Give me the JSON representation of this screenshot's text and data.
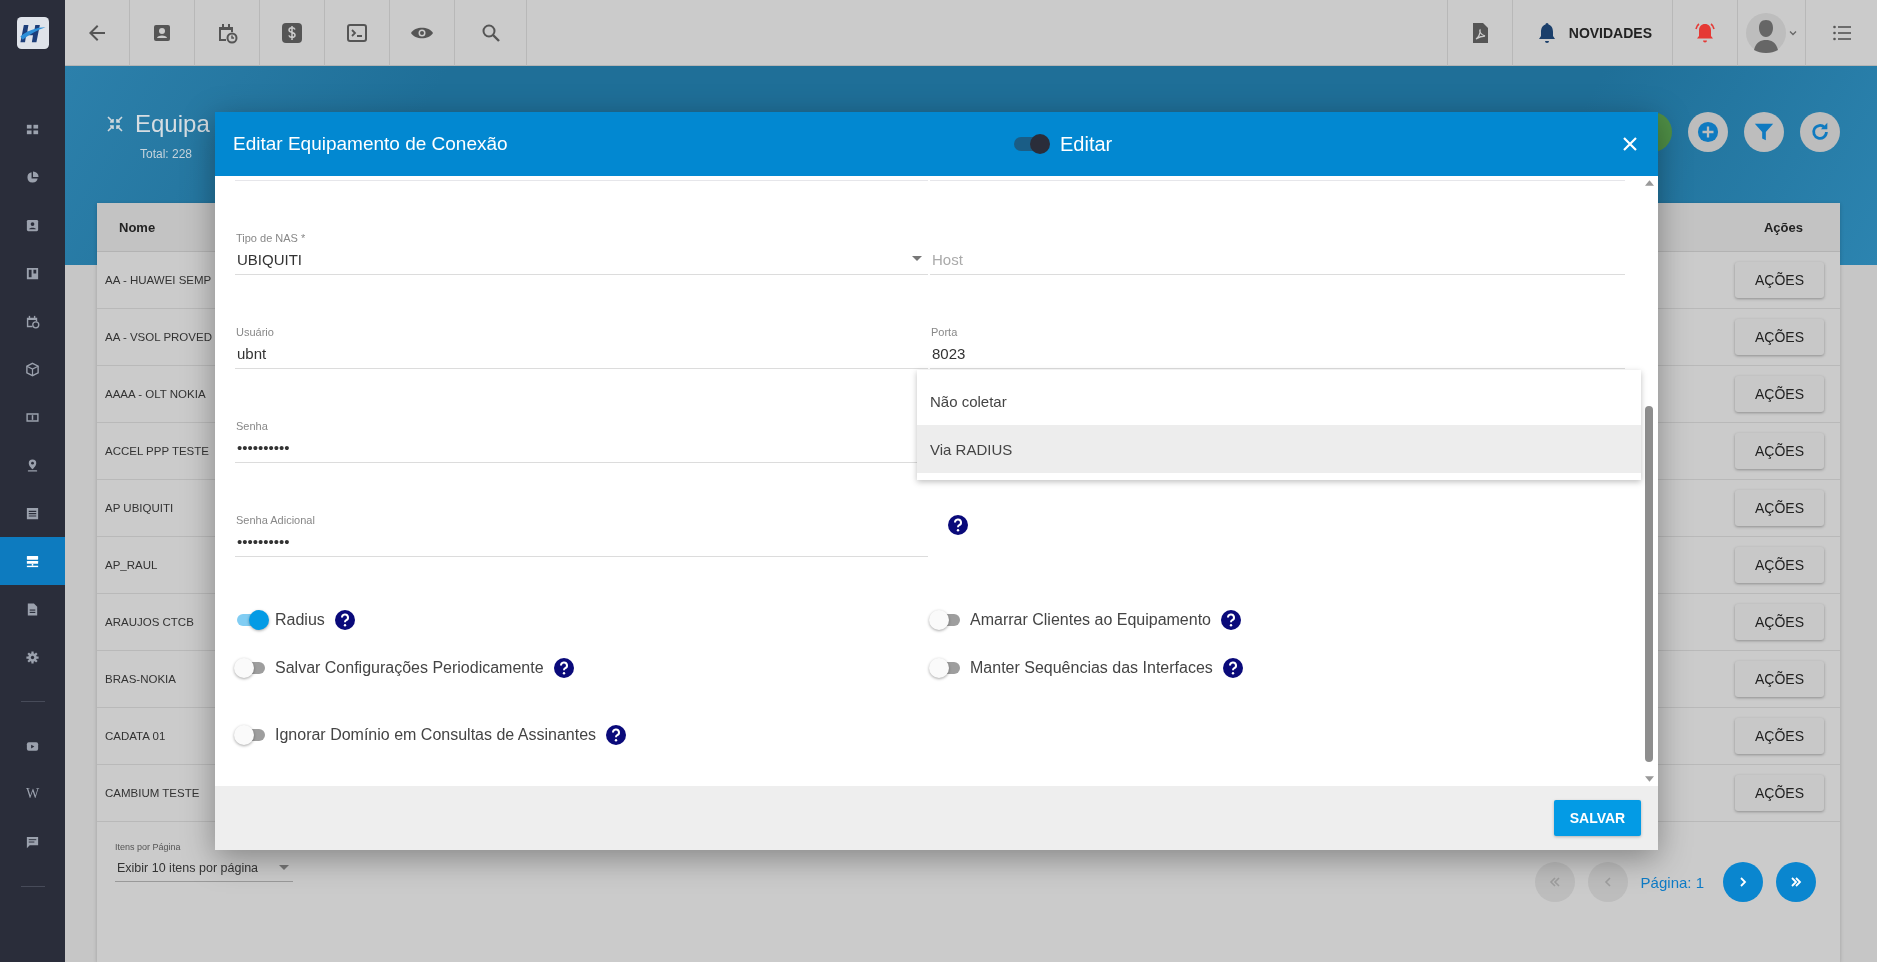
{
  "sidebar": {
    "items": [
      {
        "kind": "grid",
        "selected": false
      },
      {
        "kind": "pie",
        "selected": false
      },
      {
        "kind": "contact",
        "selected": false
      },
      {
        "kind": "board",
        "selected": false
      },
      {
        "kind": "calendar",
        "selected": false
      },
      {
        "kind": "cube",
        "selected": false
      },
      {
        "kind": "money",
        "selected": false
      },
      {
        "kind": "pin",
        "selected": false
      },
      {
        "kind": "list",
        "selected": false
      },
      {
        "kind": "server",
        "selected": true
      },
      {
        "kind": "document",
        "selected": false
      },
      {
        "kind": "gear",
        "selected": false
      },
      {
        "kind": "video",
        "selected": false
      },
      {
        "kind": "wiki",
        "label": "W",
        "selected": false
      },
      {
        "kind": "chat",
        "selected": false
      }
    ]
  },
  "top_bar": {
    "news_label": "NOVIDADES"
  },
  "page": {
    "title": "Equipa",
    "total": "Total: 228"
  },
  "table": {
    "columns": [
      "Nome",
      "Ações"
    ],
    "rows": [
      {
        "name": "AA - HUAWEI SEMP",
        "action": "AÇÕES"
      },
      {
        "name": "AA - VSOL PROVED",
        "action": "AÇÕES"
      },
      {
        "name": "AAAA - OLT NOKIA",
        "action": "AÇÕES"
      },
      {
        "name": "ACCEL PPP TESTE",
        "action": "AÇÕES"
      },
      {
        "name": "AP UBIQUITI",
        "action": "AÇÕES"
      },
      {
        "name": "AP_RAUL",
        "action": "AÇÕES"
      },
      {
        "name": "ARAUJOS CTCB",
        "action": "AÇÕES"
      },
      {
        "name": "BRAS-NOKIA",
        "action": "AÇÕES"
      },
      {
        "name": "CADATA 01",
        "action": "AÇÕES"
      },
      {
        "name": "CAMBIUM TESTE",
        "action": "AÇÕES"
      }
    ]
  },
  "pagination": {
    "per_page_label": "Itens por Página",
    "per_page_value": "Exibir 10 itens por página",
    "page_label": "Página: 1"
  },
  "modal": {
    "title": "Editar Equipamento de Conexão",
    "edit_toggle": {
      "label": "Editar",
      "on": true
    },
    "fields": [
      {
        "kind": "select",
        "label": "Tipo de NAS *",
        "value": "UBIQUITI"
      },
      {
        "kind": "text",
        "placeholder": "Host"
      },
      {
        "kind": "text",
        "label": "Usuário",
        "value": "ubnt"
      },
      {
        "kind": "text",
        "label": "Porta",
        "value": "8023"
      },
      {
        "kind": "text",
        "label": "Senha",
        "value": "••••••••••"
      },
      {
        "kind": "menu"
      },
      {
        "kind": "text",
        "label": "Senha Adicional",
        "value": "••••••••••"
      },
      {
        "kind": "help"
      }
    ],
    "menu_options": [
      {
        "label": "Não coletar",
        "selected": false
      },
      {
        "label": "Via RADIUS",
        "selected": true
      }
    ],
    "toggles": [
      {
        "label": "Radius",
        "on": true
      },
      {
        "label": "Amarrar Clientes ao Equipamento",
        "on": false
      },
      {
        "label": "Salvar Configurações Periodicamente",
        "on": false
      },
      {
        "label": "Manter Sequências das Interfaces",
        "on": false
      },
      {
        "label": "Ignorar Domínio em Consultas de Assinantes",
        "on": false
      }
    ],
    "save_button": "SALVAR"
  }
}
